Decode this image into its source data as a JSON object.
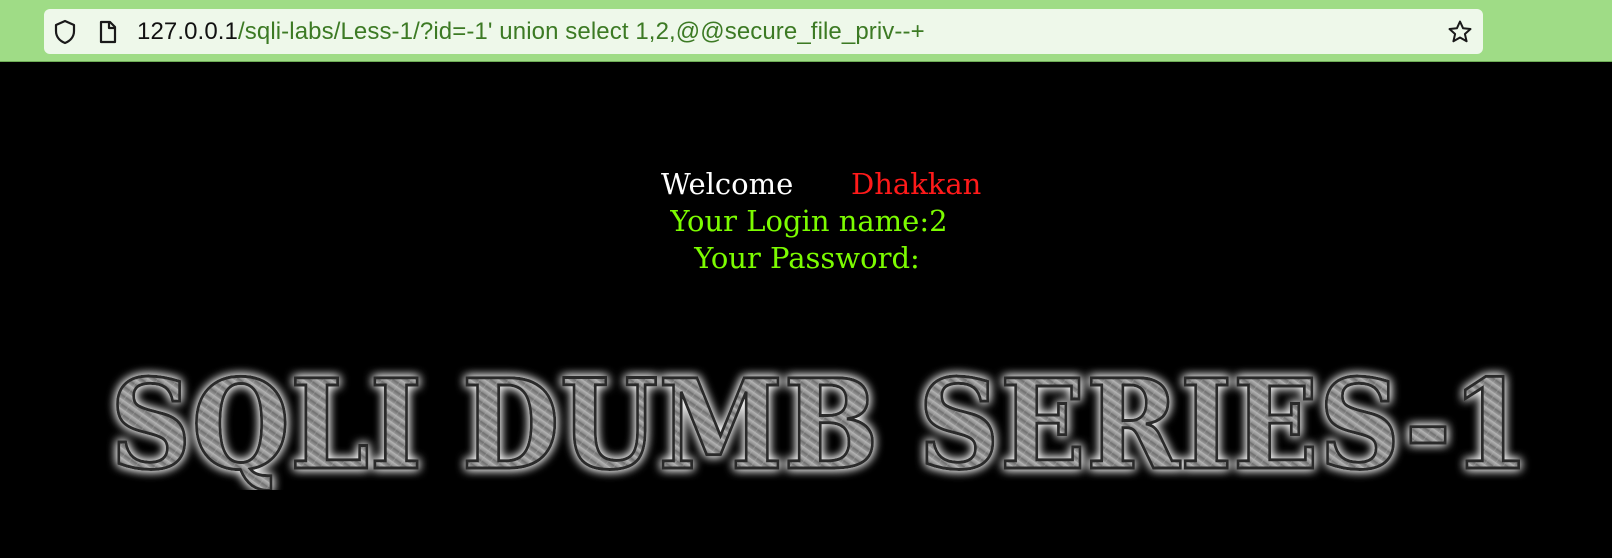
{
  "browser": {
    "url_host": "127.0.0.1",
    "url_path": "/sqli-labs/Less-1/?id=-1' union select 1,2,@@secure_file_priv--+",
    "icons": {
      "left_first": "shield-icon",
      "left_second": "page-icon",
      "right": "star-icon"
    },
    "colors": {
      "toolbar": "#9fdc86",
      "urlbar": "#eef8ea",
      "url_path": "#3c7a24"
    }
  },
  "page": {
    "background": "#000000",
    "welcome_word": "Welcome",
    "welcome_name": "Dhakkan",
    "login_line": "Your Login name:2",
    "password_line": "Your Password:",
    "banner_text": "SQLI DUMB SERIES-1",
    "colors": {
      "welcome": "#ffffff",
      "name": "#ff1a1a",
      "result": "#7cfc00",
      "banner": "#8a8a8a"
    }
  }
}
